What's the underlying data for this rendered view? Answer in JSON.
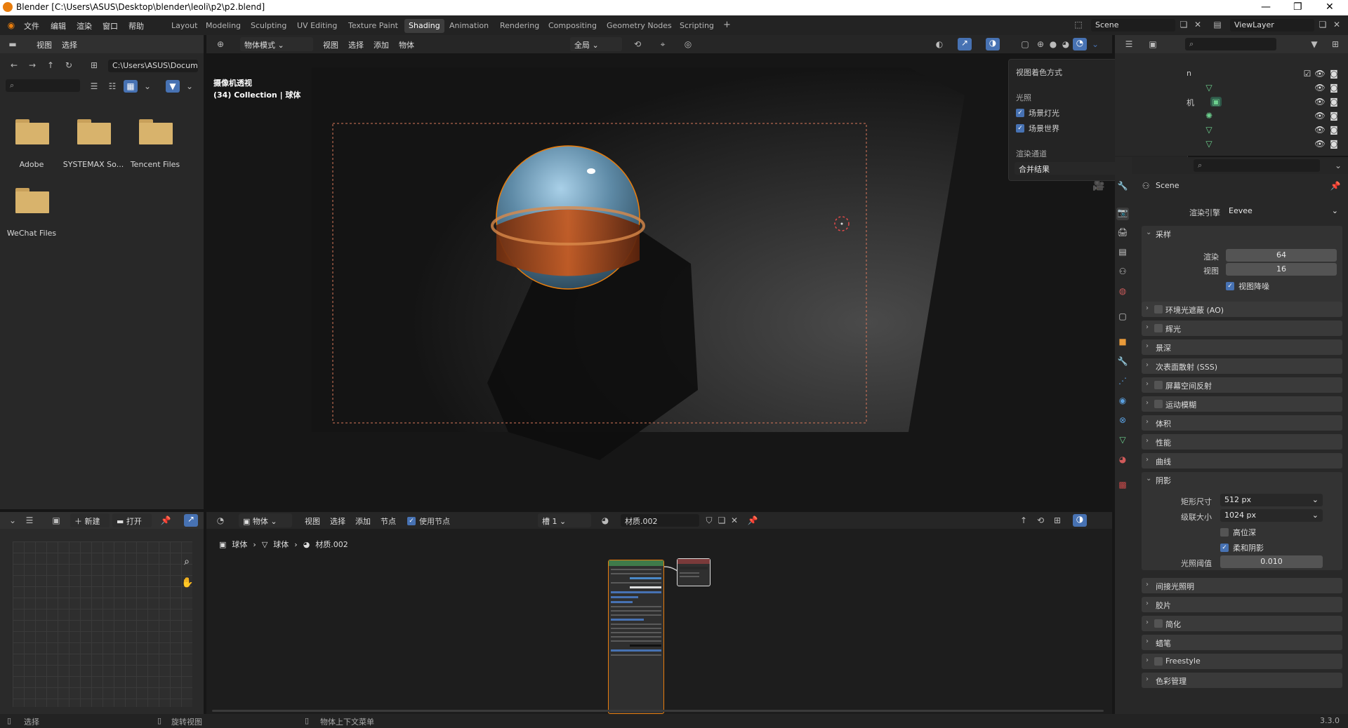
{
  "window": {
    "title": "Blender [C:\\Users\\ASUS\\Desktop\\blender\\leoli\\p2\\p2.blend]",
    "min": "—",
    "max": "❐",
    "close": "✕"
  },
  "menu": [
    "文件",
    "编辑",
    "渲染",
    "窗口",
    "帮助"
  ],
  "workspaces": [
    "Layout",
    "Modeling",
    "Sculpting",
    "UV Editing",
    "Texture Paint",
    "Shading",
    "Animation",
    "Rendering",
    "Compositing",
    "Geometry Nodes",
    "Scripting"
  ],
  "workspace_active": "Shading",
  "workspace_add": "+",
  "scene": {
    "name": "Scene",
    "view_layer": "ViewLayer"
  },
  "file_browser": {
    "menu": [
      "视图",
      "选择"
    ],
    "path": "C:\\Users\\ASUS\\Docum...",
    "folders": [
      "Adobe",
      "SYSTEMAX So...",
      "Tencent Files",
      "WeChat Files"
    ]
  },
  "viewport": {
    "mode": "物体模式",
    "menu": [
      "视图",
      "选择",
      "添加",
      "物体"
    ],
    "transform": "全局",
    "overlay_title": "摄像机透视",
    "overlay_sub": "(34) Collection | 球体"
  },
  "shading_popover": {
    "title": "视图着色方式",
    "lighting_label": "光照",
    "scene_lights": "场景灯光",
    "scene_world": "场景世界",
    "pass_label": "渲染通道",
    "pass_value": "合并结果"
  },
  "image_editor": {
    "new": "新建",
    "open": "打开"
  },
  "node_editor": {
    "type": "物体",
    "menu": [
      "视图",
      "选择",
      "添加",
      "节点"
    ],
    "use_nodes": "使用节点",
    "slot": "槽 1",
    "material": "材质.002",
    "breadcrumb": [
      "球体",
      "球体",
      "材质.002"
    ]
  },
  "outliner": {
    "partial_labels": [
      "n",
      "机"
    ]
  },
  "properties": {
    "scene_label": "Scene",
    "render_engine_label": "渲染引擎",
    "render_engine": "Eevee",
    "sampling": {
      "title": "采样",
      "render_label": "渲染",
      "render": "64",
      "viewport_label": "视图",
      "viewport": "16",
      "denoise": "视图降噪"
    },
    "sections_a": [
      "环境光遮蔽 (AO)",
      "辉光",
      "景深",
      "次表面散射 (SSS)",
      "屏幕空间反射",
      "运动模糊",
      "体积",
      "性能",
      "曲线"
    ],
    "shadows": {
      "title": "阴影",
      "cube_label": "矩形尺寸",
      "cube": "512 px",
      "cascade_label": "级联大小",
      "cascade": "1024 px",
      "high_bit": "高位深",
      "soft": "柔和阴影",
      "threshold_label": "光照阈值",
      "threshold": "0.010"
    },
    "sections_b": [
      "间接光照明",
      "胶片",
      "简化",
      "蜡笔",
      "Freestyle",
      "色彩管理"
    ]
  },
  "statusbar": {
    "select": "选择",
    "rotate": "旋转视图",
    "context": "物体上下文菜单",
    "version": "3.3.0"
  },
  "colors": {
    "accent": "#4772b3",
    "selection": "#e87d0d",
    "bg": "#232323"
  }
}
